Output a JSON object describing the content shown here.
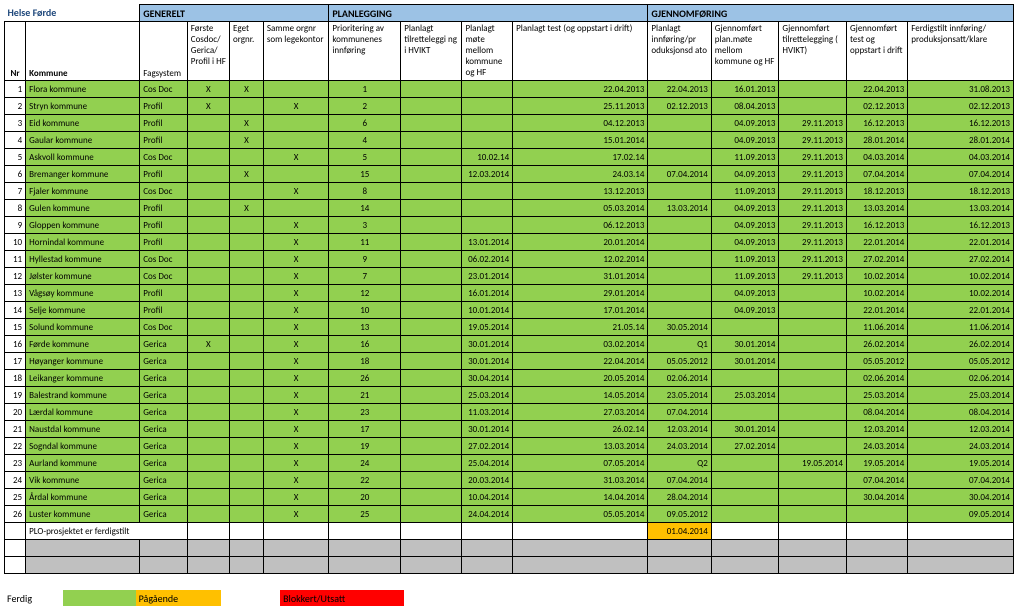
{
  "title": "Helse Førde",
  "sections": {
    "generelt": "GENERELT",
    "planlegging": "PLANLEGGING",
    "gjennomforing": "GJENNOMFØRING"
  },
  "columns": {
    "nr": "Nr",
    "kommune": "Kommune",
    "fagsystem": "Fagsystem",
    "forste": "Første\nCosdoc/\nGerica/\nProfil i\nHF",
    "eget": "Eget\norgnr.",
    "samme": "Samme orgnr\nsom\nlegekontor",
    "prior": "Prioritering av\nkommunenes\ninnføring",
    "tilrett": "Planlagt\ntilretteleggi\nng i HVIKT",
    "mote": "Planlagt\nmøte\nmellom\nkommune\nog HF",
    "test": "Planlagt test (og oppstart i\ndrift)",
    "innf": "Planlagt\ninnføring/pr\noduksjonsd\nato",
    "gjmote": "Gjennomført\nplan.møte\nmellom\nkommune og\nHF",
    "gjtil": "Gjennomført\ntilrettelegging\n( HVIKT)",
    "gjtest": "Gjennomført\ntest og\noppstart i\ndrift",
    "ferdig": "Ferdigstilt innføring/\nproduksjonsatt/klare"
  },
  "rows": [
    {
      "nr": "1",
      "kommune": "Flora kommune",
      "fs": "Cos Doc",
      "c1": "X",
      "c2": "X",
      "c3": "",
      "pr": "1",
      "pt": "",
      "pm": "",
      "test": "22.04.2013",
      "pi": "22.04.2013",
      "gm": "16.01.2013",
      "gt": "",
      "gte": "22.04.2013",
      "fe": "31.08.2013",
      "colors": {
        "b": "g",
        "c": "g",
        "d": "g",
        "e": "g",
        "f": "g",
        "g": "g",
        "h": "g",
        "i": "g",
        "j": "g",
        "k": "g",
        "l": "g",
        "m": "g",
        "n": "g",
        "o": "g"
      }
    },
    {
      "nr": "2",
      "kommune": "Stryn kommune",
      "fs": "Profil",
      "c1": "X",
      "c2": "",
      "c3": "X",
      "pr": "2",
      "pt": "",
      "pm": "",
      "test": "25.11.2013",
      "pi": "02.12.2013",
      "gm": "08.04.2013",
      "gt": "",
      "gte": "02.12.2013",
      "fe": "02.12.2013",
      "colors": {
        "b": "g",
        "c": "g",
        "d": "g",
        "e": "g",
        "f": "g",
        "g": "g",
        "h": "g",
        "i": "g",
        "j": "g",
        "k": "g",
        "l": "g",
        "m": "g",
        "n": "g",
        "o": "g"
      }
    },
    {
      "nr": "3",
      "kommune": "Eid kommune",
      "fs": "Profil",
      "c1": "",
      "c2": "X",
      "c3": "",
      "pr": "6",
      "pt": "",
      "pm": "",
      "test": "04.12.2013",
      "pi": "",
      "gm": "04.09.2013",
      "gt": "29.11.2013",
      "gte": "16.12.2013",
      "fe": "16.12.2013",
      "colors": {
        "b": "g",
        "c": "g",
        "d": "g",
        "e": "g",
        "f": "g",
        "g": "g",
        "h": "g",
        "i": "g",
        "j": "g",
        "k": "g",
        "l": "g",
        "m": "g",
        "n": "g",
        "o": "g"
      }
    },
    {
      "nr": "4",
      "kommune": "Gaular kommune",
      "fs": "Profil",
      "c1": "",
      "c2": "X",
      "c3": "",
      "pr": "4",
      "pt": "",
      "pm": "",
      "test": "15.01.2014",
      "pi": "",
      "gm": "04.09.2013",
      "gt": "29.11.2013",
      "gte": "28.01.2014",
      "fe": "28.01.2014",
      "colors": {
        "b": "g",
        "c": "g",
        "d": "g",
        "e": "g",
        "f": "g",
        "g": "g",
        "h": "g",
        "i": "g",
        "j": "g",
        "k": "g",
        "l": "g",
        "m": "g",
        "n": "g",
        "o": "g"
      }
    },
    {
      "nr": "5",
      "kommune": "Askvoll kommune",
      "fs": "Cos Doc",
      "c1": "",
      "c2": "",
      "c3": "X",
      "pr": "5",
      "pt": "",
      "pm": "10.02.14",
      "test": "17.02.14",
      "pi": "",
      "gm": "11.09.2013",
      "gt": "29.11.2013",
      "gte": "04.03.2014",
      "fe": "04.03.2014",
      "colors": {
        "b": "g",
        "c": "g",
        "d": "g",
        "e": "g",
        "f": "g",
        "g": "g",
        "h": "g",
        "i": "g",
        "j": "g",
        "k": "g",
        "l": "g",
        "m": "g",
        "n": "g",
        "o": "g"
      }
    },
    {
      "nr": "6",
      "kommune": "Bremanger kommune",
      "fs": "Profil",
      "c1": "",
      "c2": "X",
      "c3": "",
      "pr": "15",
      "pt": "",
      "pm": "12.03.2014",
      "test": "24.03.14",
      "pi": "07.04.2014",
      "gm": "04.09.2013",
      "gt": "29.11.2013",
      "gte": "07.04.2014",
      "fe": "07.04.2014",
      "colors": {
        "b": "g",
        "c": "g",
        "d": "g",
        "e": "g",
        "f": "g",
        "g": "g",
        "h": "g",
        "i": "g",
        "j": "g",
        "k": "g",
        "l": "g",
        "m": "g",
        "n": "g",
        "o": "g"
      }
    },
    {
      "nr": "7",
      "kommune": "Fjaler kommune",
      "fs": "Cos Doc",
      "c1": "",
      "c2": "",
      "c3": "X",
      "pr": "8",
      "pt": "",
      "pm": "",
      "test": "13.12.2013",
      "pi": "",
      "gm": "11.09.2013",
      "gt": "29.11.2013",
      "gte": "18.12.2013",
      "fe": "18.12.2013",
      "colors": {
        "b": "g",
        "c": "g",
        "d": "g",
        "e": "g",
        "f": "g",
        "g": "g",
        "h": "g",
        "i": "g",
        "j": "g",
        "k": "g",
        "l": "g",
        "m": "g",
        "n": "g",
        "o": "g"
      }
    },
    {
      "nr": "8",
      "kommune": "Gulen kommune",
      "fs": "Profil",
      "c1": "",
      "c2": "X",
      "c3": "",
      "pr": "14",
      "pt": "",
      "pm": "",
      "test": "05.03.2014",
      "pi": "13.03.2014",
      "gm": "04.09.2013",
      "gt": "29.11.2013",
      "gte": "13.03.2014",
      "fe": "13.03.2014",
      "colors": {
        "b": "g",
        "c": "g",
        "d": "g",
        "e": "g",
        "f": "g",
        "g": "g",
        "h": "g",
        "i": "g",
        "j": "g",
        "k": "g",
        "l": "g",
        "m": "g",
        "n": "g",
        "o": "g"
      }
    },
    {
      "nr": "9",
      "kommune": "Gloppen kommune",
      "fs": "Profil",
      "c1": "",
      "c2": "",
      "c3": "X",
      "pr": "3",
      "pt": "",
      "pm": "",
      "test": "06.12.2013",
      "pi": "",
      "gm": "04.09.2013",
      "gt": "29.11.2013",
      "gte": "16.12.2013",
      "fe": "16.12.2013",
      "colors": {
        "b": "g",
        "c": "g",
        "d": "g",
        "e": "g",
        "f": "g",
        "g": "g",
        "h": "g",
        "i": "g",
        "j": "g",
        "k": "g",
        "l": "g",
        "m": "g",
        "n": "g",
        "o": "g"
      }
    },
    {
      "nr": "10",
      "kommune": "Hornindal kommune",
      "fs": "Profil",
      "c1": "",
      "c2": "",
      "c3": "X",
      "pr": "11",
      "pt": "",
      "pm": "13.01.2014",
      "test": "20.01.2014",
      "pi": "",
      "gm": "04.09.2013",
      "gt": "29.11.2013",
      "gte": "22.01.2014",
      "fe": "22.01.2014",
      "colors": {
        "b": "g",
        "c": "g",
        "d": "g",
        "e": "g",
        "f": "g",
        "g": "g",
        "h": "g",
        "i": "g",
        "j": "g",
        "k": "g",
        "l": "g",
        "m": "g",
        "n": "g",
        "o": "g"
      }
    },
    {
      "nr": "11",
      "kommune": "Hyllestad kommune",
      "fs": "Cos Doc",
      "c1": "",
      "c2": "",
      "c3": "X",
      "pr": "9",
      "pt": "",
      "pm": "06.02.2014",
      "test": "12.02.2014",
      "pi": "",
      "gm": "11.09.2013",
      "gt": "29.11.2013",
      "gte": "27.02.2014",
      "fe": "27.02.2014",
      "colors": {
        "b": "g",
        "c": "g",
        "d": "g",
        "e": "g",
        "f": "g",
        "g": "g",
        "h": "g",
        "i": "g",
        "j": "g",
        "k": "g",
        "l": "g",
        "m": "g",
        "n": "g",
        "o": "g"
      }
    },
    {
      "nr": "12",
      "kommune": "Jølster kommune",
      "fs": "Cos Doc",
      "c1": "",
      "c2": "",
      "c3": "X",
      "pr": "7",
      "pt": "",
      "pm": "23.01.2014",
      "test": "31.01.2014",
      "pi": "",
      "gm": "11.09.2013",
      "gt": "29.11.2013",
      "gte": "10.02.2014",
      "fe": "10.02.2014",
      "colors": {
        "b": "g",
        "c": "g",
        "d": "g",
        "e": "g",
        "f": "g",
        "g": "g",
        "h": "g",
        "i": "g",
        "j": "g",
        "k": "g",
        "l": "g",
        "m": "g",
        "n": "g",
        "o": "g"
      }
    },
    {
      "nr": "13",
      "kommune": "Vågsøy kommune",
      "fs": "Profil",
      "c1": "",
      "c2": "",
      "c3": "X",
      "pr": "12",
      "pt": "",
      "pm": "16.01.2014",
      "test": "29.01.2014",
      "pi": "",
      "gm": "04.09.2013",
      "gt": "",
      "gte": "10.02.2014",
      "fe": "10.02.2014",
      "colors": {
        "b": "g",
        "c": "g",
        "d": "g",
        "e": "g",
        "f": "g",
        "g": "g",
        "h": "g",
        "i": "g",
        "j": "g",
        "k": "g",
        "l": "g",
        "m": "g",
        "n": "g",
        "o": "g"
      }
    },
    {
      "nr": "14",
      "kommune": "Selje kommune",
      "fs": "Profil",
      "c1": "",
      "c2": "",
      "c3": "X",
      "pr": "10",
      "pt": "",
      "pm": "10.01.2014",
      "test": "17.01.2014",
      "pi": "",
      "gm": "04.09.2013",
      "gt": "",
      "gte": "22.01.2014",
      "fe": "22.01.2014",
      "colors": {
        "b": "g",
        "c": "g",
        "d": "g",
        "e": "g",
        "f": "g",
        "g": "g",
        "h": "g",
        "i": "g",
        "j": "g",
        "k": "g",
        "l": "g",
        "m": "g",
        "n": "g",
        "o": "g"
      }
    },
    {
      "nr": "15",
      "kommune": "Solund kommune",
      "fs": "Cos Doc",
      "c1": "",
      "c2": "",
      "c3": "X",
      "pr": "13",
      "pt": "",
      "pm": "19.05.2014",
      "test": "21.05.14",
      "pi": "30.05.2014",
      "gm": "",
      "gt": "",
      "gte": "11.06.2014",
      "fe": "11.06.2014",
      "colors": {
        "b": "g",
        "c": "g",
        "d": "g",
        "e": "g",
        "f": "g",
        "g": "g",
        "h": "g",
        "i": "g",
        "j": "g",
        "k": "g",
        "l": "g",
        "m": "g",
        "n": "g",
        "o": "g"
      }
    },
    {
      "nr": "16",
      "kommune": "Førde kommune",
      "fs": "Gerica",
      "c1": "X",
      "c2": "",
      "c3": "X",
      "pr": "16",
      "pt": "",
      "pm": "30.01.2014",
      "test": "03.02.2014",
      "pi": "Q1",
      "gm": "30.01.2014",
      "gt": "",
      "gte": "26.02.2014",
      "fe": "26.02.2014",
      "colors": {
        "b": "g",
        "c": "g",
        "d": "g",
        "e": "g",
        "f": "g",
        "g": "g",
        "h": "g",
        "i": "g",
        "j": "g",
        "k": "g",
        "l": "g",
        "m": "g",
        "n": "g",
        "o": "g"
      }
    },
    {
      "nr": "17",
      "kommune": "Høyanger kommune",
      "fs": "Gerica",
      "c1": "",
      "c2": "",
      "c3": "X",
      "pr": "18",
      "pt": "",
      "pm": "30.01.2014",
      "test": "22.04.2014",
      "pi": "05.05.2012",
      "gm": "30.01.2014",
      "gt": "",
      "gte": "05.05.2012",
      "fe": "05.05.2012",
      "colors": {
        "b": "g",
        "c": "g",
        "d": "g",
        "e": "g",
        "f": "g",
        "g": "g",
        "h": "g",
        "i": "g",
        "j": "g",
        "k": "g",
        "l": "g",
        "m": "g",
        "n": "g",
        "o": "g"
      }
    },
    {
      "nr": "18",
      "kommune": "Leikanger kommune",
      "fs": "Gerica",
      "c1": "",
      "c2": "",
      "c3": "X",
      "pr": "26",
      "pt": "",
      "pm": "30.04.2014",
      "test": "20.05.2014",
      "pi": "02.06.2014",
      "gm": "",
      "gt": "",
      "gte": "02.06.2014",
      "fe": "02.06.2014",
      "colors": {
        "b": "g",
        "c": "g",
        "d": "g",
        "e": "g",
        "f": "g",
        "g": "g",
        "h": "g",
        "i": "g",
        "j": "g",
        "k": "g",
        "l": "g",
        "m": "g",
        "n": "g",
        "o": "g"
      }
    },
    {
      "nr": "19",
      "kommune": "Balestrand kommune",
      "fs": "Gerica",
      "c1": "",
      "c2": "",
      "c3": "X",
      "pr": "21",
      "pt": "",
      "pm": "25.03.2014",
      "test": "14.05.2014",
      "pi": "23.05.2014",
      "gm": "25.03.2014",
      "gt": "",
      "gte": "25.03.2014",
      "fe": "25.03.2014",
      "colors": {
        "b": "g",
        "c": "g",
        "d": "g",
        "e": "g",
        "f": "g",
        "g": "g",
        "h": "g",
        "i": "g",
        "j": "g",
        "k": "g",
        "l": "g",
        "m": "g",
        "n": "g",
        "o": "g"
      }
    },
    {
      "nr": "20",
      "kommune": "Lærdal kommune",
      "fs": "Gerica",
      "c1": "",
      "c2": "",
      "c3": "X",
      "pr": "23",
      "pt": "",
      "pm": "11.03.2014",
      "test": "27.03.2014",
      "pi": "07.04.2014",
      "gm": "",
      "gt": "",
      "gte": "08.04.2014",
      "fe": "08.04.2014",
      "colors": {
        "b": "g",
        "c": "g",
        "d": "g",
        "e": "g",
        "f": "g",
        "g": "g",
        "h": "g",
        "i": "g",
        "j": "g",
        "k": "g",
        "l": "g",
        "m": "g",
        "n": "g",
        "o": "g"
      }
    },
    {
      "nr": "21",
      "kommune": "Naustdal kommune",
      "fs": "Gerica",
      "c1": "",
      "c2": "",
      "c3": "X",
      "pr": "17",
      "pt": "",
      "pm": "30.01.2014",
      "test": "26.02.14",
      "pi": "12.03.2014",
      "gm": "30.01.2014",
      "gt": "",
      "gte": "12.03.2014",
      "fe": "12.03.2014",
      "colors": {
        "b": "g",
        "c": "g",
        "d": "g",
        "e": "g",
        "f": "g",
        "g": "g",
        "h": "g",
        "i": "g",
        "j": "g",
        "k": "g",
        "l": "g",
        "m": "g",
        "n": "g",
        "o": "g"
      }
    },
    {
      "nr": "22",
      "kommune": "Sogndal kommune",
      "fs": "Gerica",
      "c1": "",
      "c2": "",
      "c3": "X",
      "pr": "19",
      "pt": "",
      "pm": "27.02.2014",
      "test": "13.03.2014",
      "pi": "24.03.2014",
      "gm": "27.02.2014",
      "gt": "",
      "gte": "24.03.2014",
      "fe": "24.03.2014",
      "colors": {
        "b": "g",
        "c": "g",
        "d": "g",
        "e": "g",
        "f": "g",
        "g": "g",
        "h": "g",
        "i": "g",
        "j": "g",
        "k": "g",
        "l": "g",
        "m": "g",
        "n": "g",
        "o": "g"
      }
    },
    {
      "nr": "23",
      "kommune": "Aurland kommune",
      "fs": "Gerica",
      "c1": "",
      "c2": "",
      "c3": "X",
      "pr": "24",
      "pt": "",
      "pm": "25.04.2014",
      "test": "07.05.2014",
      "pi": "Q2",
      "gm": "",
      "gt": "19.05.2014",
      "gte": "19.05.2014",
      "fe": "19.05.2014",
      "colors": {
        "b": "g",
        "c": "g",
        "d": "g",
        "e": "g",
        "f": "g",
        "g": "g",
        "h": "g",
        "i": "g",
        "j": "g",
        "k": "g",
        "l": "g",
        "m": "g",
        "n": "g",
        "o": "g"
      }
    },
    {
      "nr": "24",
      "kommune": "Vik kommune",
      "fs": "Gerica",
      "c1": "",
      "c2": "",
      "c3": "X",
      "pr": "22",
      "pt": "",
      "pm": "20.03.2014",
      "test": "31.03.2014",
      "pi": "07.04.2014",
      "gm": "",
      "gt": "",
      "gte": "07.04.2014",
      "fe": "07.04.2014",
      "colors": {
        "b": "g",
        "c": "g",
        "d": "g",
        "e": "g",
        "f": "g",
        "g": "g",
        "h": "g",
        "i": "g",
        "j": "g",
        "k": "g",
        "l": "g",
        "m": "g",
        "n": "g",
        "o": "g"
      }
    },
    {
      "nr": "25",
      "kommune": "Årdal kommune",
      "fs": "Gerica",
      "c1": "",
      "c2": "",
      "c3": "X",
      "pr": "20",
      "pt": "",
      "pm": "10.04.2014",
      "test": "14.04.2014",
      "pi": "28.04.2014",
      "gm": "",
      "gt": "",
      "gte": "30.04.2014",
      "fe": "30.04.2014",
      "colors": {
        "b": "g",
        "c": "g",
        "d": "g",
        "e": "g",
        "f": "g",
        "g": "g",
        "h": "g",
        "i": "g",
        "j": "g",
        "k": "g",
        "l": "g",
        "m": "g",
        "n": "g",
        "o": "g"
      }
    },
    {
      "nr": "26",
      "kommune": "Luster kommune",
      "fs": "Gerica",
      "c1": "",
      "c2": "",
      "c3": "X",
      "pr": "25",
      "pt": "",
      "pm": "24.04.2014",
      "test": "05.05.2014",
      "pi": "09.05.2012",
      "gm": "",
      "gt": "",
      "gte": "",
      "fe": "09.05.2014",
      "colors": {
        "b": "g",
        "c": "g",
        "d": "g",
        "e": "g",
        "f": "g",
        "g": "g",
        "h": "g",
        "i": "g",
        "j": "g",
        "k": "g",
        "l": "g",
        "m": "g",
        "n": "g",
        "o": "g"
      }
    }
  ],
  "footer_row": {
    "text": "PLO-prosjektet er ferdigstilt",
    "date": "01.04.2014"
  },
  "legend": {
    "ferdig": "Ferdig",
    "pagaende": "Pågående",
    "blokkert": "Blokkert/Utsatt"
  }
}
